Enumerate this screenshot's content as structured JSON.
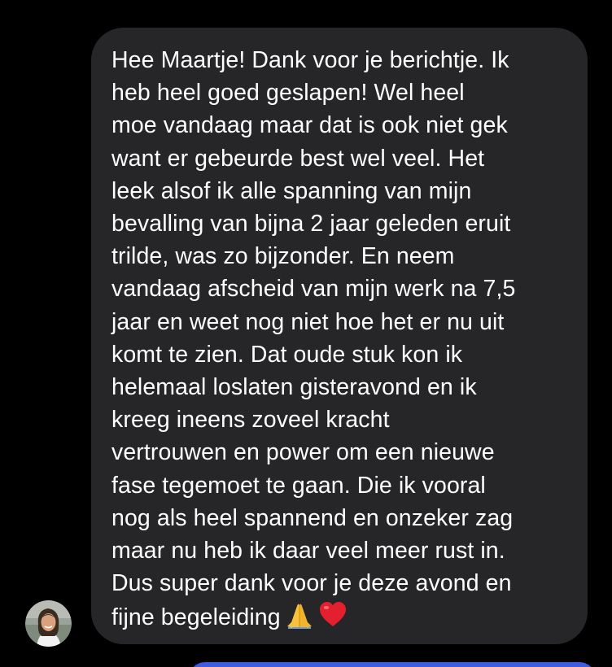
{
  "conversation": {
    "incoming_message": {
      "lines": [
        "Hee Maartje! Dank voor je berichtje. Ik",
        "heb heel goed geslapen! Wel heel",
        "moe vandaag maar dat is ook niet gek",
        "want er gebeurde best wel veel. Het",
        "leek alsof ik alle spanning van mijn",
        "bevalling van bijna 2 jaar geleden eruit",
        "trilde, was zo bijzonder. En neem",
        "vandaag afscheid van mijn werk na 7,5",
        "jaar en weet nog niet hoe het er nu uit",
        "komt te zien. Dat oude stuk kon ik",
        "helemaal loslaten gisteravond en ik",
        "kreeg ineens zoveel kracht",
        "vertrouwen en power om een nieuwe",
        "fase tegemoet te gaan. Die ik vooral",
        "nog als heel spannend en onzeker zag",
        "maar nu heb ik daar veel meer rust in.",
        "Dus super dank voor je deze avond en",
        "fijne begeleiding"
      ],
      "emojis": [
        "folded-hands-icon",
        "red-heart-icon"
      ]
    },
    "colors": {
      "background": "#000000",
      "incoming_bubble": "#262629",
      "text": "#ffffff",
      "outgoing_bubble": "#3d5ce0"
    }
  }
}
